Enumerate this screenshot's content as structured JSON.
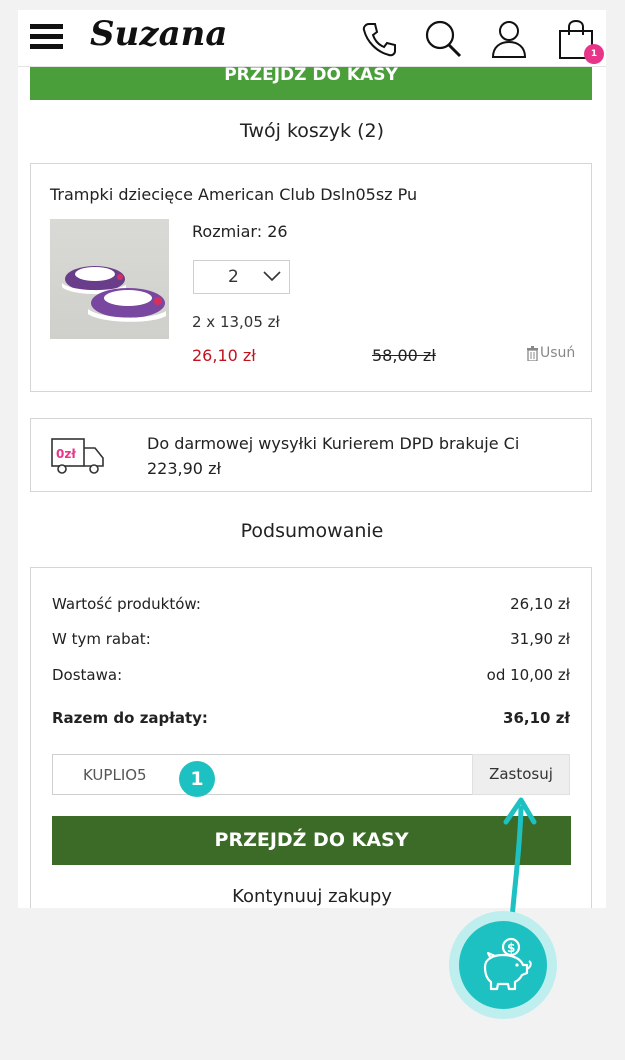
{
  "header": {
    "logo": "Suzana",
    "cart_count": "1",
    "icons": [
      "menu-icon",
      "phone-icon",
      "search-icon",
      "user-icon",
      "shopping-bag-icon"
    ]
  },
  "top_checkout_label": "PRZEJDŹ DO KASY",
  "cart": {
    "title": "Twój koszyk (2)",
    "item": {
      "name": "Trampki dziecięce American Club Dsln05sz Pu",
      "size": "Rozmiar: 26",
      "quantity": "2",
      "unit_price": "2 x 13,05 zł",
      "price_new": "26,10 zł",
      "price_old": "58,00 zł",
      "remove_label": "Usuń"
    }
  },
  "shipping": {
    "icon_text": "0zł",
    "message": "Do darmowej wysyłki Kurierem DPD brakuje Ci 223,90 zł"
  },
  "summary": {
    "title": "Podsumowanie",
    "rows": [
      {
        "label": "Wartość produktów:",
        "value": "26,10 zł"
      },
      {
        "label": "W tym rabat:",
        "value": "31,90 zł"
      },
      {
        "label": "Dostawa:",
        "value": "od 10,00 zł"
      }
    ],
    "total": {
      "label": "Razem do zapłaty:",
      "value": "36,10 zł"
    },
    "coupon_value": "KUPLIO5",
    "apply_label": "Zastosuj",
    "step_badge": "1",
    "checkout_label": "PRZEJDŹ DO KASY",
    "continue_label": "Kontynuuj zakupy"
  },
  "colors": {
    "accent_green": "#4a9f3a",
    "dark_green": "#3b6b27",
    "price_red": "#c1121f",
    "badge_pink": "#e8358a",
    "teal": "#1ec1c1"
  }
}
